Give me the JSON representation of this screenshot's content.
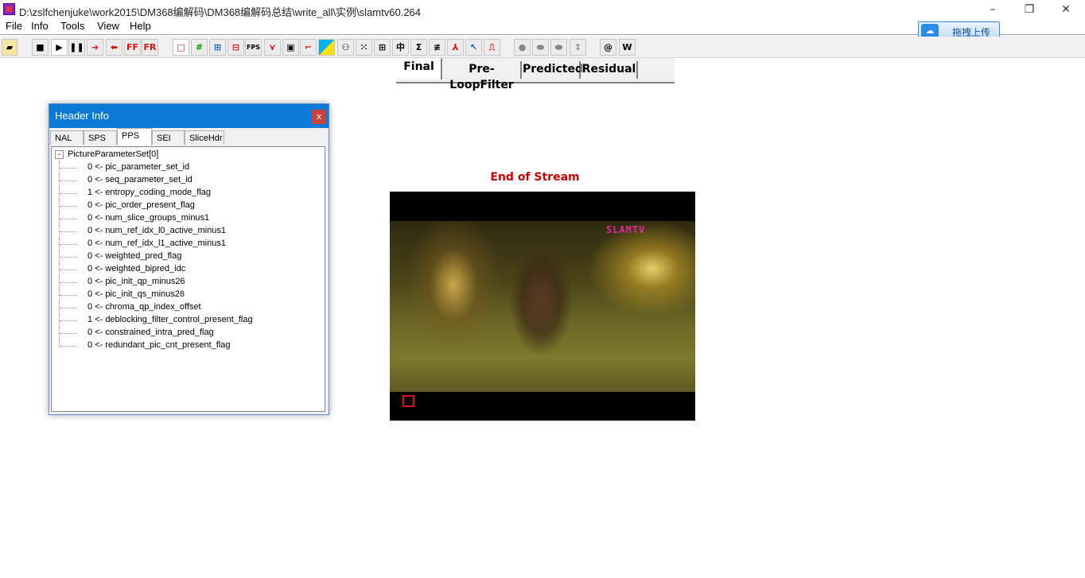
{
  "window": {
    "title": "D:\\zslfchenjuke\\work2015\\DM368编解码\\DM368编解码总结\\write_all\\实例\\slamtv60.264"
  },
  "menu": {
    "items": [
      "File",
      "Info",
      "Tools",
      "View",
      "Help"
    ]
  },
  "upload": {
    "label": "拖拽上传"
  },
  "toolbar": {
    "ff_label": "FF",
    "fr_label": "FR",
    "fps_label": "FPS",
    "at_label": "@",
    "w_label": "W"
  },
  "view_tabs": [
    "Final",
    "Pre-LoopFilter",
    "Predicted",
    "Residual"
  ],
  "view_tabs_active": "Final",
  "header_panel": {
    "title": "Header Info",
    "close": "x",
    "tabs": [
      "NAL",
      "SPS",
      "PPS",
      "SEI",
      "SliceHdr"
    ],
    "active_tab": "PPS",
    "root": "PictureParameterSet[0]",
    "rows": [
      "0 <- pic_parameter_set_id",
      "0 <- seq_parameter_set_id",
      "1 <- entropy_coding_mode_flag",
      "0 <- pic_order_present_flag",
      "0 <- num_slice_groups_minus1",
      "0 <- num_ref_idx_l0_active_minus1",
      "0 <- num_ref_idx_l1_active_minus1",
      "0 <- weighted_pred_flag",
      "0 <- weighted_bipred_idc",
      "0 <- pic_init_qp_minus26",
      "0 <- pic_init_qs_minus26",
      "0 <- chroma_qp_index_offset",
      "1 <- deblocking_filter_control_present_flag",
      "0 <- constrained_intra_pred_flag",
      "0 <- redundant_pic_cnt_present_flag"
    ]
  },
  "viewer": {
    "status": "End of Stream",
    "watermark": "SLAMTV"
  },
  "colors": {
    "status_red": "#cc0000",
    "panel_title_blue": "#0a7ad6",
    "watermark_pink": "#e02a9a"
  }
}
